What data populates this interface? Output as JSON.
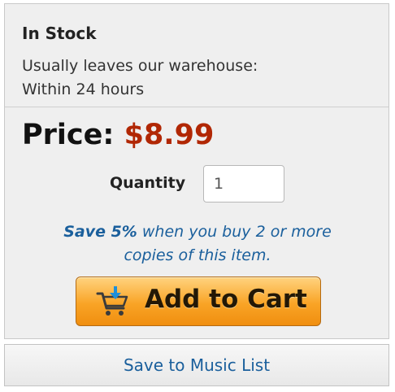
{
  "stock": {
    "title": "In Stock",
    "ship_line1": "Usually leaves our warehouse:",
    "ship_line2": "Within 24 hours"
  },
  "price": {
    "label": "Price:",
    "value": "$8.99",
    "value_color": "#b12704"
  },
  "quantity": {
    "label": "Quantity",
    "value": "1"
  },
  "promo": {
    "bold": "Save 5%",
    "line1_rest": " when you buy 2 or more",
    "line2": "copies of this item.",
    "color": "#1a5f9c"
  },
  "cart_button": {
    "label": "Add to Cart",
    "icon": "shopping-cart-icon"
  },
  "list_button": {
    "label": "Save to Music List"
  }
}
